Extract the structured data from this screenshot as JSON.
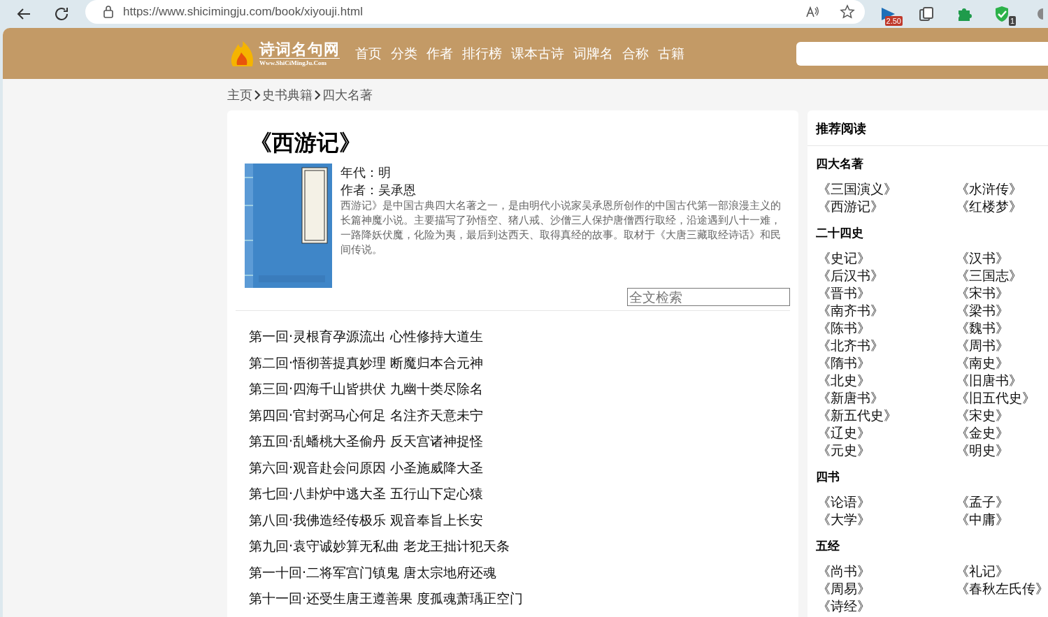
{
  "browser": {
    "url": "https://www.shicimingju.com/book/xiyouji.html",
    "extensions": [
      {
        "kind": "media",
        "badge": "2.50"
      },
      {
        "kind": "collections"
      },
      {
        "kind": "puzzle"
      },
      {
        "kind": "shield",
        "badge": "1"
      },
      {
        "kind": "partial"
      }
    ]
  },
  "header": {
    "logo_title": "诗词名句网",
    "logo_subtitle": "Www.ShiCiMingJu.Com",
    "nav": [
      "首页",
      "分类",
      "作者",
      "排行榜",
      "课本古诗",
      "词牌名",
      "合称",
      "古籍"
    ]
  },
  "breadcrumb": [
    "主页",
    "史书典籍",
    "四大名著"
  ],
  "book": {
    "title": "《西游记》",
    "era": "年代：明",
    "author": "作者：吴承恩",
    "description": "西游记》是中国古典四大名著之一，是由明代小说家吴承恩所创作的中国古代第一部浪漫主义的长篇神魔小说。主要描写了孙悟空、猪八戒、沙僧三人保护唐僧西行取经，沿途遇到八十一难，一路降妖伏魔，化险为夷，最后到达西天、取得真经的故事。取材于《大唐三藏取经诗话》和民间传说。",
    "search": {
      "placeholder": "全文检索"
    }
  },
  "chapters": [
    "第一回·灵根育孕源流出 心性修持大道生",
    "第二回·悟彻菩提真妙理 断魔归本合元神",
    "第三回·四海千山皆拱伏 九幽十类尽除名",
    "第四回·官封弼马心何足 名注齐天意未宁",
    "第五回·乱蟠桃大圣偷丹 反天宫诸神捉怪",
    "第六回·观音赴会问原因 小圣施威降大圣",
    "第七回·八卦炉中逃大圣 五行山下定心猿",
    "第八回·我佛造经传极乐 观音奉旨上长安",
    "第九回·袁守诚妙算无私曲 老龙王拙计犯天条",
    "第一十回·二将军宫门镇鬼 唐太宗地府还魂",
    "第十一回·还受生唐王遵善果 度孤魂萧瑀正空门"
  ],
  "sidebar": {
    "title": "推荐阅读",
    "groups": [
      {
        "title": "四大名著",
        "items": [
          "《三国演义》",
          "《水浒传》",
          "《西游记》",
          "《红楼梦》"
        ]
      },
      {
        "title": "二十四史",
        "items": [
          "《史记》",
          "《汉书》",
          "《后汉书》",
          "《三国志》",
          "《晋书》",
          "《宋书》",
          "《南齐书》",
          "《梁书》",
          "《陈书》",
          "《魏书》",
          "《北齐书》",
          "《周书》",
          "《隋书》",
          "《南史》",
          "《北史》",
          "《旧唐书》",
          "《新唐书》",
          "《旧五代史》",
          "《新五代史》",
          "《宋史》",
          "《辽史》",
          "《金史》",
          "《元史》",
          "《明史》"
        ]
      },
      {
        "title": "四书",
        "items": [
          "《论语》",
          "《孟子》",
          "《大学》",
          "《中庸》"
        ]
      },
      {
        "title": "五经",
        "items": [
          "《尚书》",
          "《礼记》",
          "《周易》",
          "《春秋左氏传》",
          "《诗经》"
        ]
      }
    ]
  }
}
